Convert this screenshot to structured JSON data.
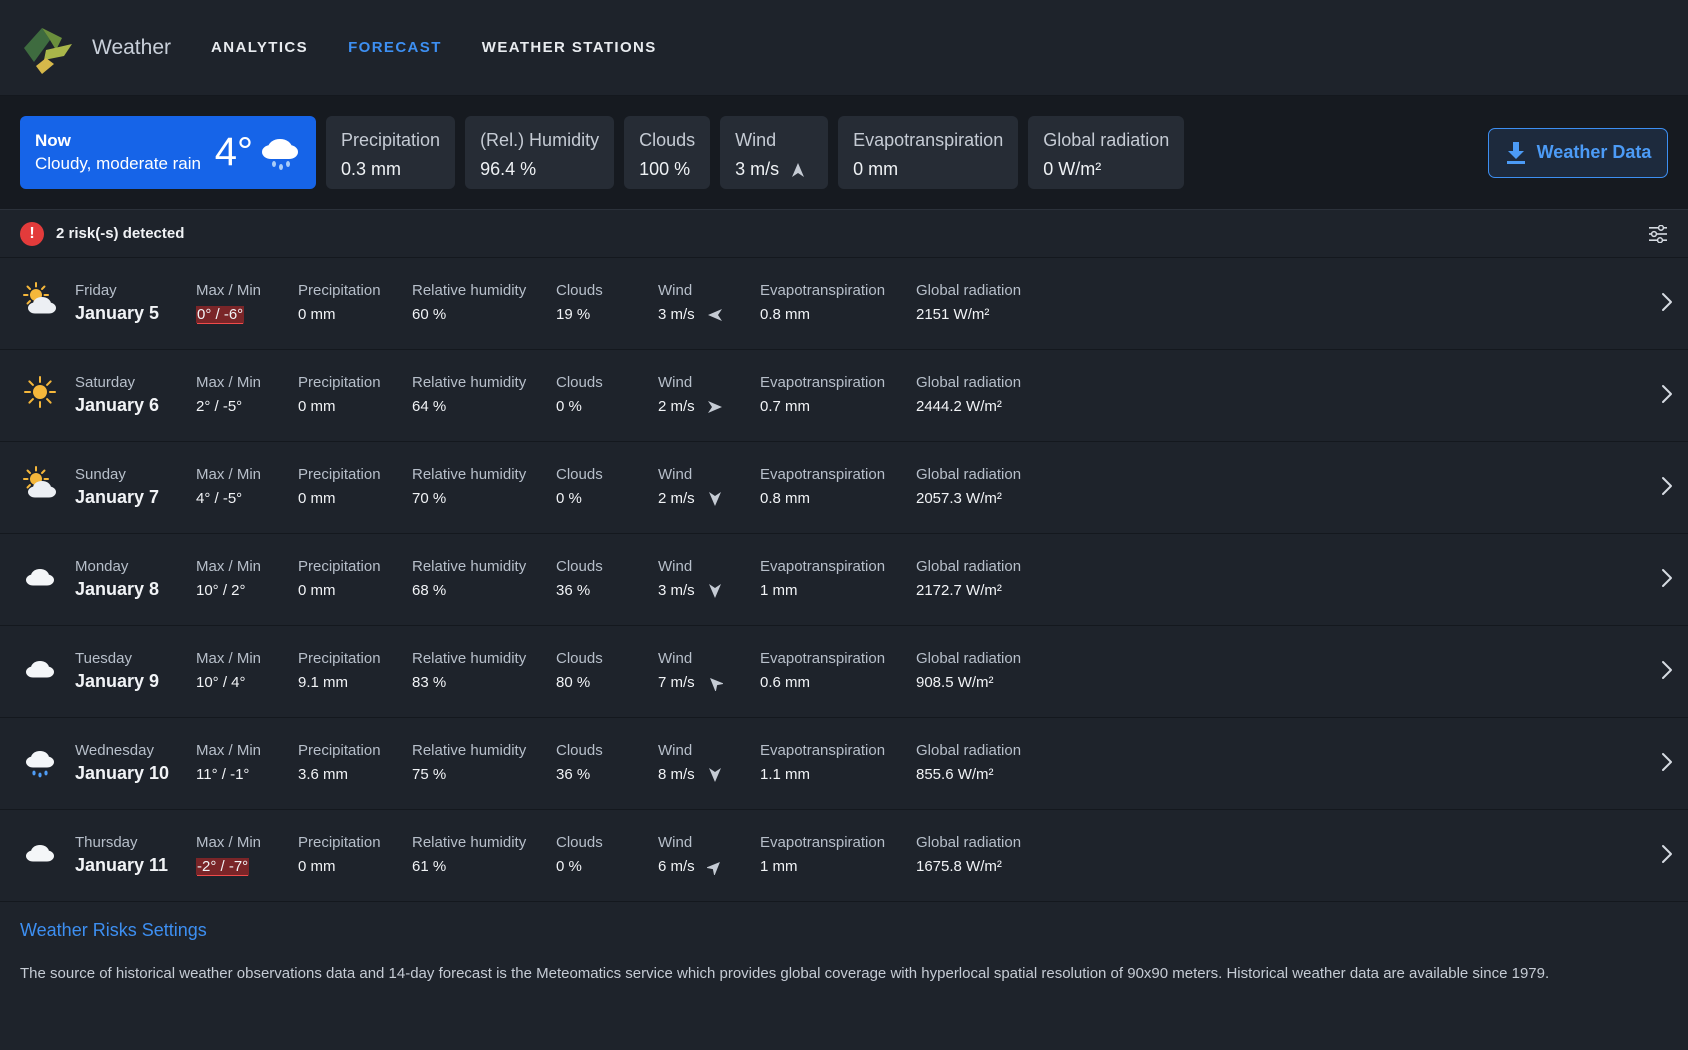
{
  "header": {
    "app_name": "Weather",
    "logo_icon": "leaf-logo",
    "tabs": [
      {
        "label": "ANALYTICS",
        "active": false
      },
      {
        "label": "FORECAST",
        "active": true
      },
      {
        "label": "WEATHER STATIONS",
        "active": false
      }
    ]
  },
  "current": {
    "label": "Now",
    "description": "Cloudy, moderate rain",
    "temperature": "4°",
    "icon": "cloud-rain-icon",
    "metrics": [
      {
        "label": "Precipitation",
        "value": "0.3 mm"
      },
      {
        "label": "(Rel.) Humidity",
        "value": "96.4 %"
      },
      {
        "label": "Clouds",
        "value": "100 %"
      },
      {
        "label": "Wind",
        "value": "3 m/s",
        "direction": "up"
      },
      {
        "label": "Evapotranspiration",
        "value": "0 mm"
      },
      {
        "label": "Global radiation",
        "value": "0 W/m²"
      }
    ],
    "download_label": "Weather Data"
  },
  "risk": {
    "text": "2 risk(-s) detected",
    "icon_glyph": "!"
  },
  "columns": {
    "maxmin": "Max / Min",
    "precipitation": "Precipitation",
    "humidity": "Relative humidity",
    "clouds": "Clouds",
    "wind": "Wind",
    "evapotranspiration": "Evapotranspiration",
    "radiation": "Global radiation"
  },
  "days": [
    {
      "weekday": "Friday",
      "date": "January 5",
      "icon": "sun-cloud-icon",
      "maxmin": "0° / -6°",
      "risk": true,
      "precipitation": "0 mm",
      "humidity": "60 %",
      "clouds": "19 %",
      "wind": "3 m/s",
      "wind_dir": "left",
      "evapotranspiration": "0.8 mm",
      "radiation": "2151 W/m²"
    },
    {
      "weekday": "Saturday",
      "date": "January 6",
      "icon": "sun-icon",
      "maxmin": "2° / -5°",
      "risk": false,
      "precipitation": "0 mm",
      "humidity": "64 %",
      "clouds": "0 %",
      "wind": "2 m/s",
      "wind_dir": "right",
      "evapotranspiration": "0.7 mm",
      "radiation": "2444.2 W/m²"
    },
    {
      "weekday": "Sunday",
      "date": "January 7",
      "icon": "sun-cloud-icon",
      "maxmin": "4° / -5°",
      "risk": false,
      "precipitation": "0 mm",
      "humidity": "70 %",
      "clouds": "0 %",
      "wind": "2 m/s",
      "wind_dir": "down",
      "evapotranspiration": "0.8 mm",
      "radiation": "2057.3 W/m²"
    },
    {
      "weekday": "Monday",
      "date": "January 8",
      "icon": "cloud-icon",
      "maxmin": "10° / 2°",
      "risk": false,
      "precipitation": "0 mm",
      "humidity": "68 %",
      "clouds": "36 %",
      "wind": "3 m/s",
      "wind_dir": "down",
      "evapotranspiration": "1 mm",
      "radiation": "2172.7 W/m²"
    },
    {
      "weekday": "Tuesday",
      "date": "January 9",
      "icon": "cloud-icon",
      "maxmin": "10° / 4°",
      "risk": false,
      "precipitation": "9.1 mm",
      "humidity": "83 %",
      "clouds": "80 %",
      "wind": "7 m/s",
      "wind_dir": "up-left",
      "evapotranspiration": "0.6 mm",
      "radiation": "908.5 W/m²"
    },
    {
      "weekday": "Wednesday",
      "date": "January 10",
      "icon": "cloud-rain-icon",
      "maxmin": "11° / -1°",
      "risk": false,
      "precipitation": "3.6 mm",
      "humidity": "75 %",
      "clouds": "36 %",
      "wind": "8 m/s",
      "wind_dir": "down",
      "evapotranspiration": "1.1 mm",
      "radiation": "855.6 W/m²"
    },
    {
      "weekday": "Thursday",
      "date": "January 11",
      "icon": "cloud-icon",
      "maxmin": "-2° / -7°",
      "risk": true,
      "precipitation": "0 mm",
      "humidity": "61 %",
      "clouds": "0 %",
      "wind": "6 m/s",
      "wind_dir": "up-right",
      "evapotranspiration": "1 mm",
      "radiation": "1675.8 W/m²"
    }
  ],
  "footer": {
    "link": "Weather Risks Settings",
    "note": "The source of historical weather observations data and 14-day forecast is the Meteomatics service which provides global coverage with hyperlocal spatial resolution of 90x90 meters. Historical weather data are available since 1979."
  },
  "colors": {
    "accent": "#3d8ff2",
    "now_card": "#1664e8",
    "risk": "#e33b3b",
    "sun": "#f5b73b"
  }
}
